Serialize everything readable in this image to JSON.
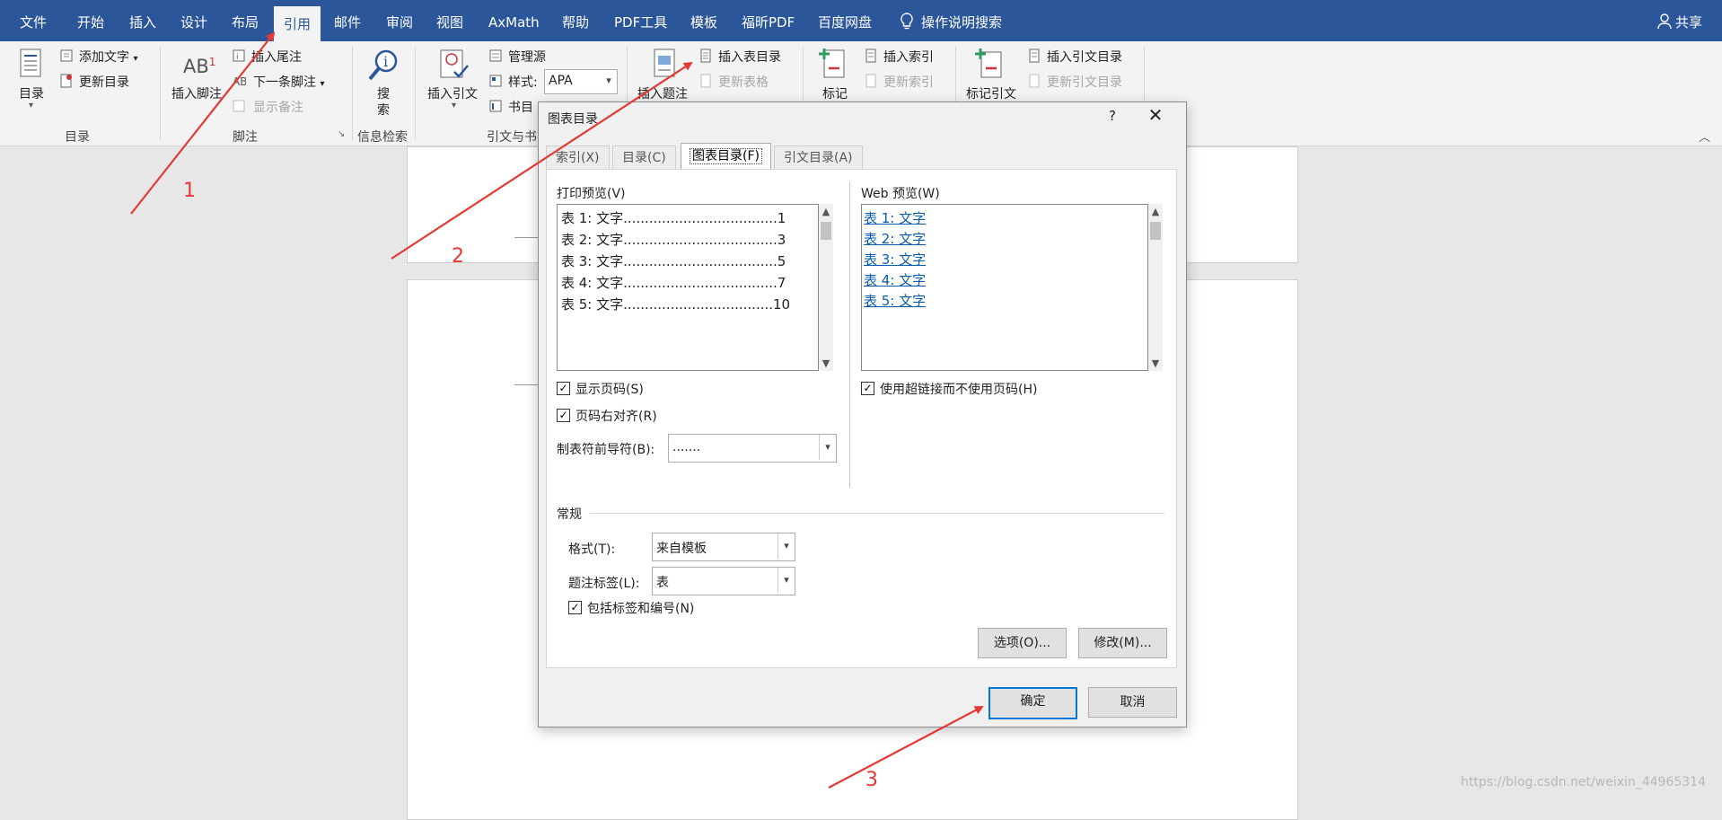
{
  "menubar": {
    "items": [
      "文件",
      "开始",
      "插入",
      "设计",
      "布局",
      "引用",
      "邮件",
      "审阅",
      "视图",
      "AxMath",
      "帮助",
      "PDF工具",
      "模板",
      "福昕PDF",
      "百度网盘"
    ],
    "active": "引用",
    "tell_me": "操作说明搜索",
    "share": "共享"
  },
  "ribbon": {
    "toc": {
      "big": "目录",
      "add_text": "添加文字",
      "update_toc": "更新目录",
      "group": "目录"
    },
    "footnotes": {
      "insert_footnote": "插入脚注",
      "insert_endnote": "插入尾注",
      "next_footnote": "下一条脚注",
      "show_notes": "显示备注",
      "group": "脚注"
    },
    "research": {
      "search_line1": "搜",
      "search_line2": "索",
      "group": "信息检索"
    },
    "citations": {
      "insert_citation": "插入引文",
      "manage_sources": "管理源",
      "style_label": "样式:",
      "style_value": "APA",
      "bibliography": "书目",
      "group": "引文与书"
    },
    "captions": {
      "insert_caption": "插入题注",
      "insert_table_of_figures": "插入表目录",
      "update_table": "更新表格"
    },
    "index": {
      "mark_entry": "标记",
      "insert_index": "插入索引",
      "update_index": "更新索引"
    },
    "authorities": {
      "mark_citation": "标记引文",
      "insert_table_of_authorities": "插入引文目录",
      "update_table_of_authorities": "更新引文目录"
    }
  },
  "dialog": {
    "title": "图表目录",
    "help": "?",
    "close": "✕",
    "tabs": [
      "索引(X)",
      "目录(C)",
      "图表目录(F)",
      "引文目录(A)"
    ],
    "active_tab": "图表目录(F)",
    "print_preview_label": "打印预览(V)",
    "print_preview_lines": [
      "表 1: 文字....................................1",
      "表 2: 文字....................................3",
      "表 3: 文字....................................5",
      "表 4: 文字....................................7",
      "表 5: 文字...................................10"
    ],
    "web_preview_label": "Web 预览(W)",
    "web_preview_links": [
      "表 1: 文字",
      "表 2: 文字",
      "表 3: 文字",
      "表 4: 文字",
      "表 5: 文字"
    ],
    "show_page_numbers": {
      "label": "显示页码(S)",
      "checked": true
    },
    "right_align": {
      "label": "页码右对齐(R)",
      "checked": true
    },
    "use_hyperlinks": {
      "label": "使用超链接而不使用页码(H)",
      "checked": true
    },
    "tab_leader_label": "制表符前导符(B):",
    "tab_leader_value": ".......",
    "general_label": "常规",
    "formats_label": "格式(T):",
    "formats_value": "来自模板",
    "caption_label_label": "题注标签(L):",
    "caption_label_value": "表",
    "include_label": {
      "label": "包括标签和编号(N)",
      "checked": true
    },
    "options_button": "选项(O)...",
    "modify_button": "修改(M)...",
    "ok_button": "确定",
    "cancel_button": "取消"
  },
  "annotations": {
    "step1": "1",
    "step2": "2",
    "step3": "3",
    "color": "#e53935"
  },
  "watermark": "https://blog.csdn.net/weixin_44965314",
  "colors": {
    "title_bar": "#2b579a",
    "ribbon": "#f3f3f3",
    "doc_bg": "#e7e7e7",
    "link": "#0b5cad",
    "ok_border": "#0078d7"
  }
}
